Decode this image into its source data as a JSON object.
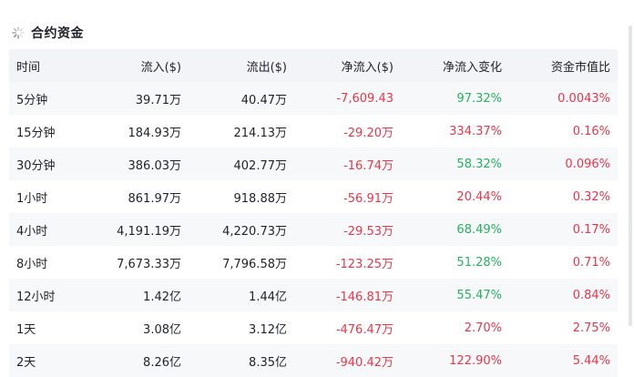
{
  "section": {
    "title": "合约资金",
    "icon": "spinner-icon"
  },
  "colors": {
    "positive": "#26b25d",
    "negative": "#e8374a"
  },
  "table": {
    "headers": [
      "时间",
      "流入($)",
      "流出($)",
      "净流入($)",
      "净流入变化",
      "资金市值比"
    ],
    "rows": [
      {
        "period": "5分钟",
        "inflow": "39.71万",
        "outflow": "40.47万",
        "net": "-7,609.43",
        "change": "97.32%",
        "ratio": "0.0043%"
      },
      {
        "period": "15分钟",
        "inflow": "184.93万",
        "outflow": "214.13万",
        "net": "-29.20万",
        "change": "334.37%",
        "ratio": "0.16%"
      },
      {
        "period": "30分钟",
        "inflow": "386.03万",
        "outflow": "402.77万",
        "net": "-16.74万",
        "change": "58.32%",
        "ratio": "0.096%"
      },
      {
        "period": "1小时",
        "inflow": "861.97万",
        "outflow": "918.88万",
        "net": "-56.91万",
        "change": "20.44%",
        "ratio": "0.32%"
      },
      {
        "period": "4小时",
        "inflow": "4,191.19万",
        "outflow": "4,220.73万",
        "net": "-29.53万",
        "change": "68.49%",
        "ratio": "0.17%"
      },
      {
        "period": "8小时",
        "inflow": "7,673.33万",
        "outflow": "7,796.58万",
        "net": "-123.25万",
        "change": "51.28%",
        "ratio": "0.71%"
      },
      {
        "period": "12小时",
        "inflow": "1.42亿",
        "outflow": "1.44亿",
        "net": "-146.81万",
        "change": "55.47%",
        "ratio": "0.84%"
      },
      {
        "period": "1天",
        "inflow": "3.08亿",
        "outflow": "3.12亿",
        "net": "-476.47万",
        "change": "2.70%",
        "ratio": "2.75%"
      },
      {
        "period": "2天",
        "inflow": "8.26亿",
        "outflow": "8.35亿",
        "net": "-940.42万",
        "change": "122.90%",
        "ratio": "5.44%"
      }
    ],
    "change_colors": [
      "green",
      "red",
      "green",
      "red",
      "green",
      "green",
      "green",
      "red",
      "red"
    ]
  }
}
